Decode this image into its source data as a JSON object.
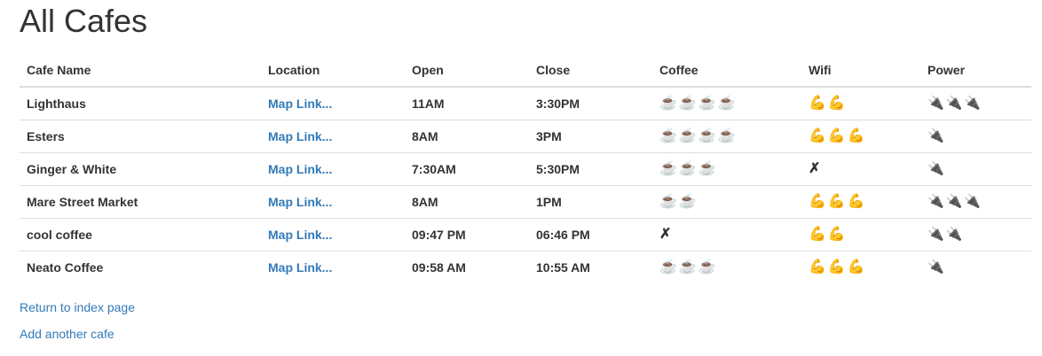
{
  "page": {
    "title": "All Cafes"
  },
  "table": {
    "headers": [
      "Cafe Name",
      "Location",
      "Open",
      "Close",
      "Coffee",
      "Wifi",
      "Power"
    ],
    "rows": [
      {
        "name": "Lighthaus",
        "location": "Map Link...",
        "open": "11AM",
        "close": "3:30PM",
        "coffee": 4,
        "wifi": 2,
        "power": 3
      },
      {
        "name": "Esters",
        "location": "Map Link...",
        "open": "8AM",
        "close": "3PM",
        "coffee": 4,
        "wifi": 3,
        "power": 1
      },
      {
        "name": "Ginger & White",
        "location": "Map Link...",
        "open": "7:30AM",
        "close": "5:30PM",
        "coffee": 3,
        "wifi": 0,
        "power": 1
      },
      {
        "name": "Mare Street Market",
        "location": "Map Link...",
        "open": "8AM",
        "close": "1PM",
        "coffee": 2,
        "wifi": 3,
        "power": 3
      },
      {
        "name": "cool coffee",
        "location": "Map Link...",
        "open": "09:47 PM",
        "close": "06:46 PM",
        "coffee": 0,
        "wifi": 2,
        "power": 2
      },
      {
        "name": "Neato Coffee",
        "location": "Map Link...",
        "open": "09:58 AM",
        "close": "10:55 AM",
        "coffee": 3,
        "wifi": 3,
        "power": 1
      }
    ]
  },
  "icons": {
    "coffee": "coffee-cup-icon",
    "wifi": "flexed-biceps-icon",
    "power": "electric-plug-icon",
    "none": "cross-mark-icon"
  },
  "glyphs": {
    "coffee": "☕",
    "wifi": "💪",
    "power": "🔌",
    "none": "✗"
  },
  "links": {
    "return_index": "Return to index page",
    "add_cafe": "Add another cafe"
  },
  "colors": {
    "link": "#337ab7",
    "text": "#333333",
    "border": "#dddddd"
  }
}
